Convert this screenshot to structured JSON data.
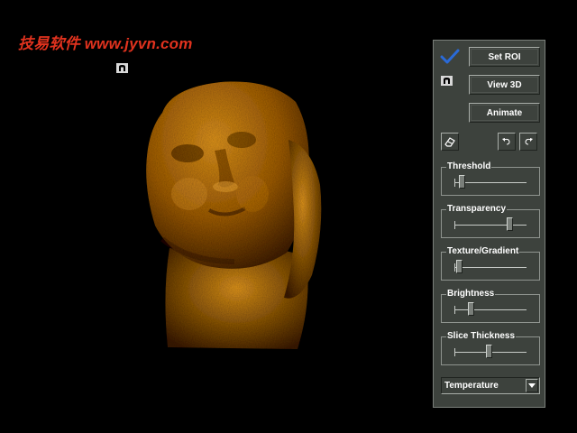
{
  "watermark": {
    "text": "技易软件 www.jyvn.com"
  },
  "colors": {
    "watermark": "#e0321e",
    "panel_bg": "#3d423d",
    "panel_text": "#ffffff",
    "button_bg": "#3d423d",
    "track": "#c8ccc8",
    "thumb": "#7a7f7a",
    "check": "#2a6ad8",
    "volume_bright": "#d9901e",
    "volume_mid": "#9a5a0e",
    "volume_dark": "#3a1c04"
  },
  "icons": {
    "mode_small": "auto-mode-icon",
    "check": "checkmark-icon",
    "mode": "auto-mode-icon",
    "eraser": "eraser-icon",
    "undo": "undo-icon",
    "redo": "redo-icon",
    "dropdown": "triangle-down-icon"
  },
  "panel": {
    "buttons": {
      "set_roi": "Set ROI",
      "view_3d": "View 3D",
      "animate": "Animate"
    },
    "sliders": [
      {
        "label": "Threshold",
        "value": 0.1
      },
      {
        "label": "Transparency",
        "value": 0.76
      },
      {
        "label": "Texture/Gradient",
        "value": 0.06
      },
      {
        "label": "Brightness",
        "value": 0.23
      },
      {
        "label": "Slice Thickness",
        "value": 0.47
      }
    ],
    "color_map": {
      "selected": "Temperature"
    }
  }
}
